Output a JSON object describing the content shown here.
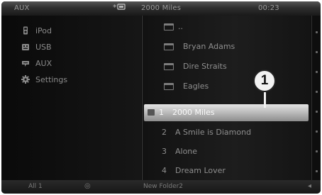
{
  "status_bar": {
    "source": "AUX",
    "indicator_symbol": "*",
    "track_title": "2000 Miles",
    "clock": "00:23"
  },
  "menu": {
    "items": [
      {
        "label": "iPod",
        "icon": "ipod-icon"
      },
      {
        "label": "USB",
        "icon": "usb-icon"
      },
      {
        "label": "AUX",
        "icon": "aux-icon"
      },
      {
        "label": "Settings",
        "icon": "gear-icon"
      }
    ]
  },
  "list": {
    "folders": [
      {
        "name": ".."
      },
      {
        "name": "Bryan Adams"
      },
      {
        "name": "Dire Straits"
      },
      {
        "name": "Eagles"
      }
    ],
    "tracks": [
      {
        "number": "1",
        "title": "2000 Miles",
        "selected": true
      },
      {
        "number": "2",
        "title": "A Smile is Diamond",
        "selected": false
      },
      {
        "number": "3",
        "title": "Alone",
        "selected": false
      },
      {
        "number": "4",
        "title": "Dream Lover",
        "selected": false
      }
    ]
  },
  "callout": {
    "label": "1"
  },
  "bottom_bar": {
    "left": "All 1",
    "mid_symbol": "◎",
    "folder": "New Folder2",
    "right_symbol": "◂"
  },
  "colors": {
    "background": "#0b0b0b",
    "selected_row": "#c8c8c8",
    "text": "#8e8e8e"
  }
}
